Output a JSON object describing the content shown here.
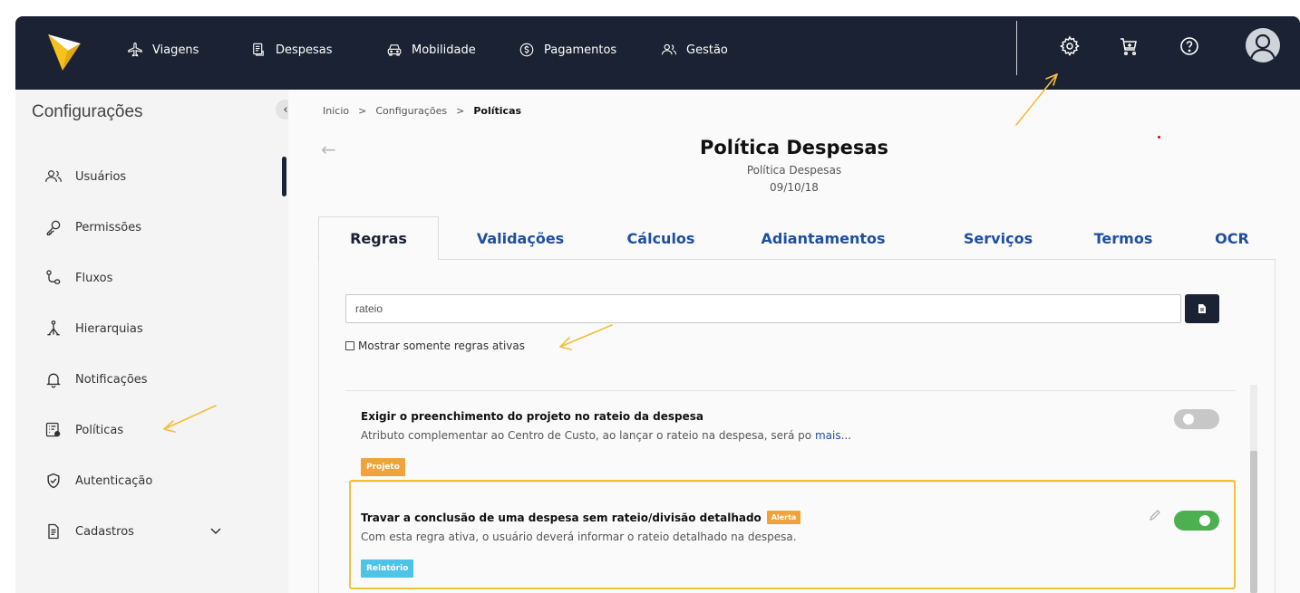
{
  "nav": {
    "items": [
      {
        "label": "Viagens",
        "icon": "airplane-icon"
      },
      {
        "label": "Despesas",
        "icon": "receipt-icon"
      },
      {
        "label": "Mobilidade",
        "icon": "car-icon"
      },
      {
        "label": "Pagamentos",
        "icon": "dollar-icon"
      },
      {
        "label": "Gestão",
        "icon": "users-icon"
      }
    ],
    "right_icons": [
      "gear-icon",
      "cart-icon",
      "help-icon",
      "user-avatar-icon"
    ]
  },
  "sidebar": {
    "title": "Configurações",
    "items": [
      {
        "label": "Usuários",
        "icon": "users-icon"
      },
      {
        "label": "Permissões",
        "icon": "key-icon"
      },
      {
        "label": "Fluxos",
        "icon": "flow-icon"
      },
      {
        "label": "Hierarquias",
        "icon": "hierarchy-icon"
      },
      {
        "label": "Notificações",
        "icon": "bell-icon"
      },
      {
        "label": "Políticas",
        "icon": "policy-icon"
      },
      {
        "label": "Autenticação",
        "icon": "shield-icon"
      },
      {
        "label": "Cadastros",
        "icon": "document-icon"
      }
    ]
  },
  "breadcrumb": {
    "items": [
      "Inicio",
      "Configurações",
      "Políticas"
    ],
    "separator": ">"
  },
  "page": {
    "title": "Política Despesas",
    "subtitle": "Política Despesas",
    "date": "09/10/18"
  },
  "tabs": [
    "Regras",
    "Validações",
    "Cálculos",
    "Adiantamentos",
    "Serviços",
    "Termos",
    "OCR"
  ],
  "search": {
    "value": "rateio"
  },
  "filter": {
    "label": "Mostrar somente regras ativas",
    "checked": false
  },
  "rules": [
    {
      "title": "Exigir o preenchimento do projeto no rateio da despesa",
      "description": "Atributo complementar ao Centro de Custo, ao lançar o rateio na despesa, será po",
      "more_link": "mais...",
      "tag": "Projeto",
      "active": false
    },
    {
      "title": "Travar a conclusão de uma despesa sem rateio/divisão detalhado",
      "badge": "Alerta",
      "description": "Com esta regra ativa, o usuário deverá informar o rateio detalhado na despesa.",
      "tag": "Relatório",
      "active": true
    }
  ],
  "colors": {
    "topbar": "#1a2233",
    "accent_blue": "#1f4fa3",
    "tag_orange": "#f2a23a",
    "tag_blue": "#4ec3e6",
    "toggle_on": "#4caf50",
    "highlight": "#f0c23a",
    "annotation_arrow": "#f5bc3a"
  }
}
